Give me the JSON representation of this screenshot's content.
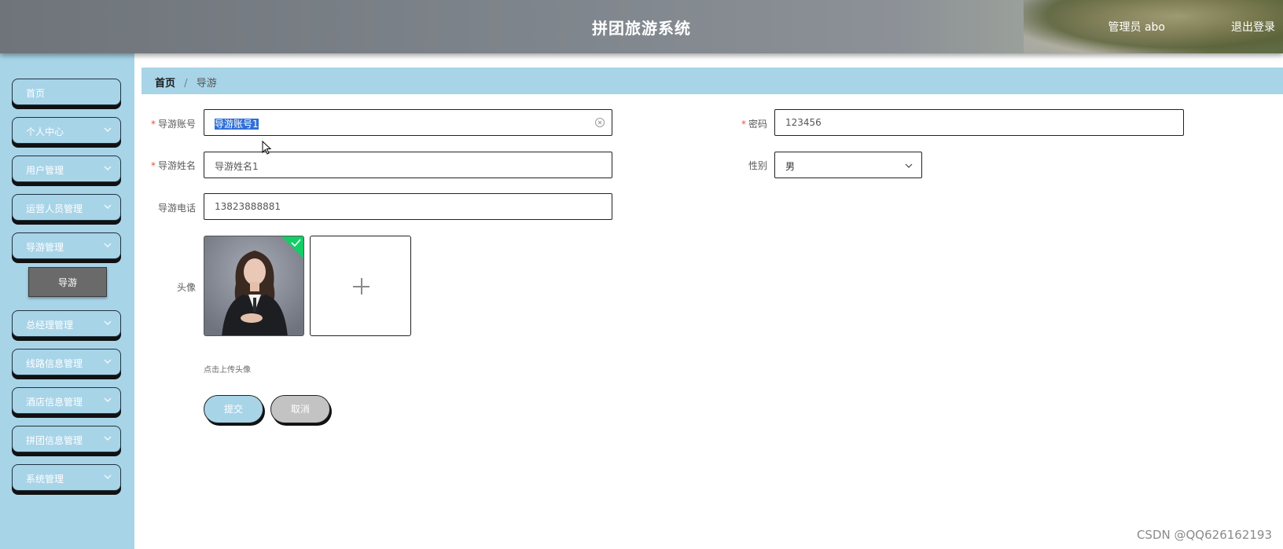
{
  "header": {
    "title": "拼团旅游系统",
    "user": "管理员 abo",
    "logout": "退出登录"
  },
  "sidebar": {
    "items": [
      {
        "label": "首页",
        "has_chevron": false
      },
      {
        "label": "个人中心",
        "has_chevron": true
      },
      {
        "label": "用户管理",
        "has_chevron": true
      },
      {
        "label": "运营人员管理",
        "has_chevron": true
      },
      {
        "label": "导游管理",
        "has_chevron": true
      },
      {
        "label": "总经理管理",
        "has_chevron": true
      },
      {
        "label": "线路信息管理",
        "has_chevron": true
      },
      {
        "label": "酒店信息管理",
        "has_chevron": true
      },
      {
        "label": "拼团信息管理",
        "has_chevron": true
      },
      {
        "label": "系统管理",
        "has_chevron": true
      }
    ],
    "active_sub": "导游"
  },
  "breadcrumb": {
    "home": "首页",
    "current": "导游"
  },
  "form": {
    "account": {
      "label": "导游账号",
      "required": true,
      "value": "导游账号1"
    },
    "password": {
      "label": "密码",
      "required": true,
      "value": "123456"
    },
    "name": {
      "label": "导游姓名",
      "required": true,
      "value": "导游姓名1"
    },
    "gender": {
      "label": "性别",
      "required": false,
      "value": "男"
    },
    "phone": {
      "label": "导游电话",
      "required": false,
      "value": "13823888881"
    },
    "avatar": {
      "label": "头像",
      "hint": "点击上传头像"
    },
    "submit": "提交",
    "cancel": "取消"
  },
  "watermark": "CSDN @QQ626162193",
  "colors": {
    "sidebar_bg": "#a8d4e8",
    "submenu_active": "#6a6a6a",
    "required": "#e5533b",
    "upload_ok": "#13ce66"
  }
}
